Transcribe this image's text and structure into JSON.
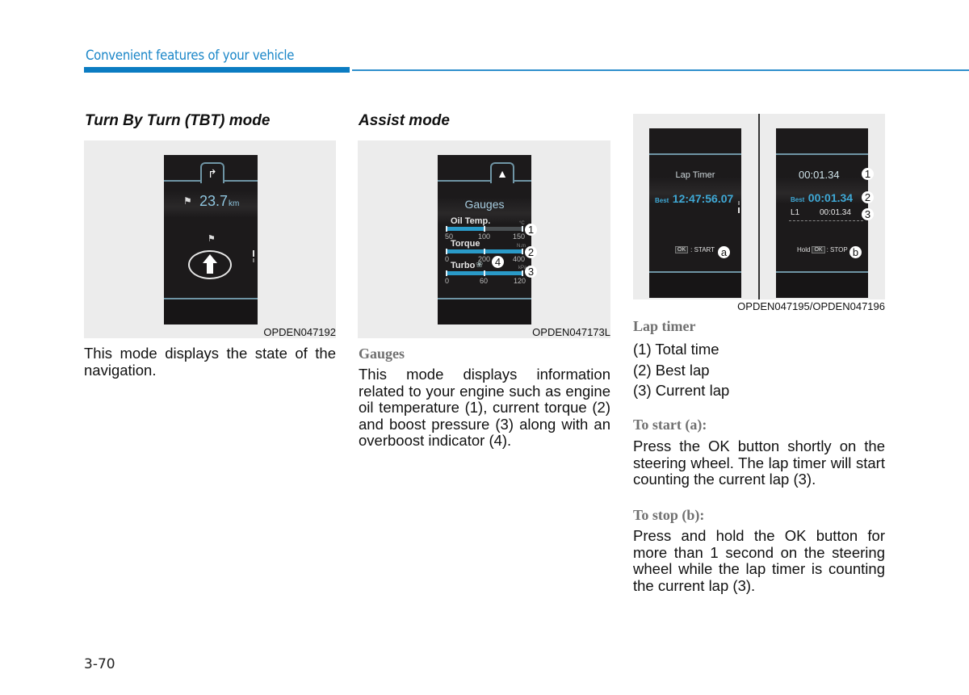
{
  "header": {
    "title": "Convenient features of your vehicle"
  },
  "columns": {
    "tbt": {
      "title": "Turn By Turn (TBT) mode",
      "figure_caption": "OPDEN047192",
      "screen": {
        "tab_icon": "turn-right-arrow-icon",
        "distance_value": "23.7",
        "distance_unit": "km"
      },
      "body": "This mode displays the state of the navigation."
    },
    "assist": {
      "title": "Assist mode",
      "figure_caption": "OPDEN047173L",
      "screen": {
        "tab_icon": "road-lanes-icon",
        "title": "Gauges",
        "gauges": [
          {
            "label": "Oil Temp.",
            "unit": "°C",
            "scale": [
              "50",
              "100",
              "150"
            ],
            "fill_fraction": 0.5,
            "callout": "1"
          },
          {
            "label": "Torque",
            "unit": "N.m",
            "scale": [
              "0",
              "200",
              "400"
            ],
            "fill_fraction": 1.0,
            "callout": "2"
          },
          {
            "label": "Turbo",
            "unit": "kPa",
            "scale": [
              "0",
              "60",
              "120"
            ],
            "fill_fraction": 1.0,
            "callout": "3"
          }
        ],
        "overboost_callout": "4"
      },
      "subheading": "Gauges",
      "body": "This mode displays information related to your engine such as engine oil temperature (1), current torque (2) and boost pressure (3) along with an overboost indicator (4)."
    },
    "laptimer": {
      "figure_caption": "OPDEN047195/OPDEN047196",
      "screen_left": {
        "title": "Lap Timer",
        "best_label": "Best",
        "best_value": "12:47:56.07",
        "ok_label": "OK",
        "action": ": START",
        "callout": "a"
      },
      "screen_right": {
        "total": "00:01.34",
        "best_label": "Best",
        "best_value": "00:01.34",
        "lap_label": "L1",
        "lap_value": "00:01.34",
        "hold_label": "Hold",
        "ok_label": "OK",
        "action": ": STOP",
        "callouts": [
          "1",
          "2",
          "3",
          "b"
        ]
      },
      "heading": "Lap timer",
      "items": [
        "(1) Total time",
        "(2) Best lap",
        "(3) Current lap"
      ],
      "start_heading": "To start (a):",
      "start_body": "Press the OK button shortly on the steering wheel. The lap timer will start counting the current lap (3).",
      "stop_heading": "To stop (b):",
      "stop_body": "Press and hold the OK button for more than 1 second on the steering wheel while the lap timer is counting the current lap (3)."
    }
  },
  "footer": {
    "page_number": "3-70"
  }
}
